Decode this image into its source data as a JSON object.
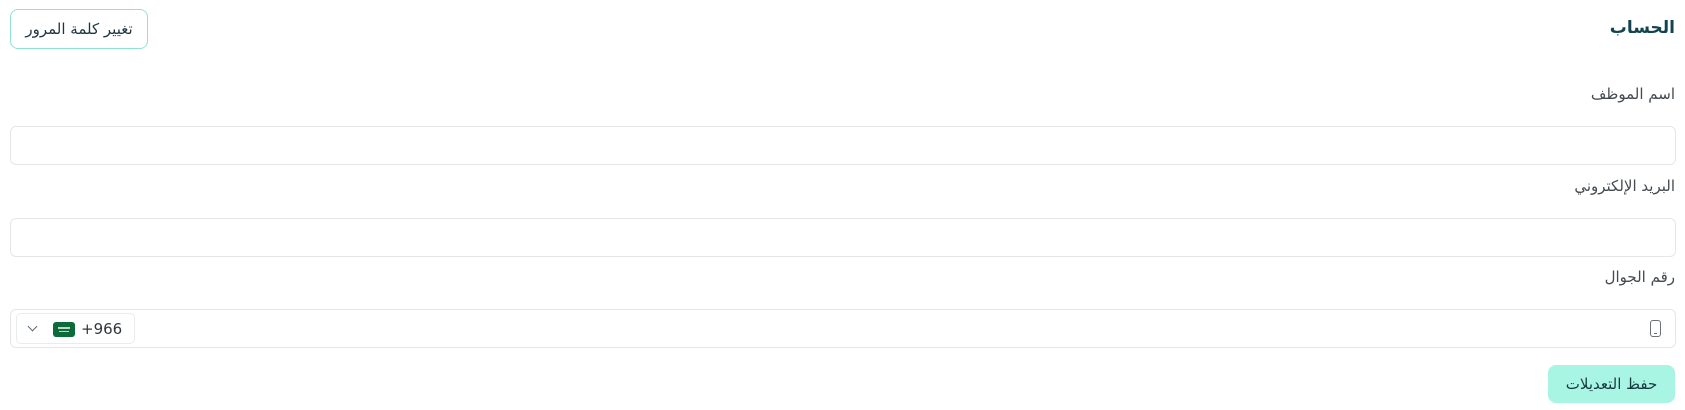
{
  "header": {
    "title": "الحساب",
    "change_password_label": "تغيير كلمة المرور"
  },
  "form": {
    "employee_name": {
      "label": "اسم الموظف",
      "value": ""
    },
    "email": {
      "label": "البريد الإلكتروني",
      "value": ""
    },
    "mobile": {
      "label": "رقم الجوال",
      "dial_code": "+966",
      "country_flag": "saudi-arabia-flag",
      "icon": "mobile-phone-icon",
      "value": ""
    },
    "save_label": "حفظ التعديلات"
  },
  "colors": {
    "accent": "#a8f5e4",
    "accent_border": "#8fe3d3",
    "title": "#13444d"
  }
}
